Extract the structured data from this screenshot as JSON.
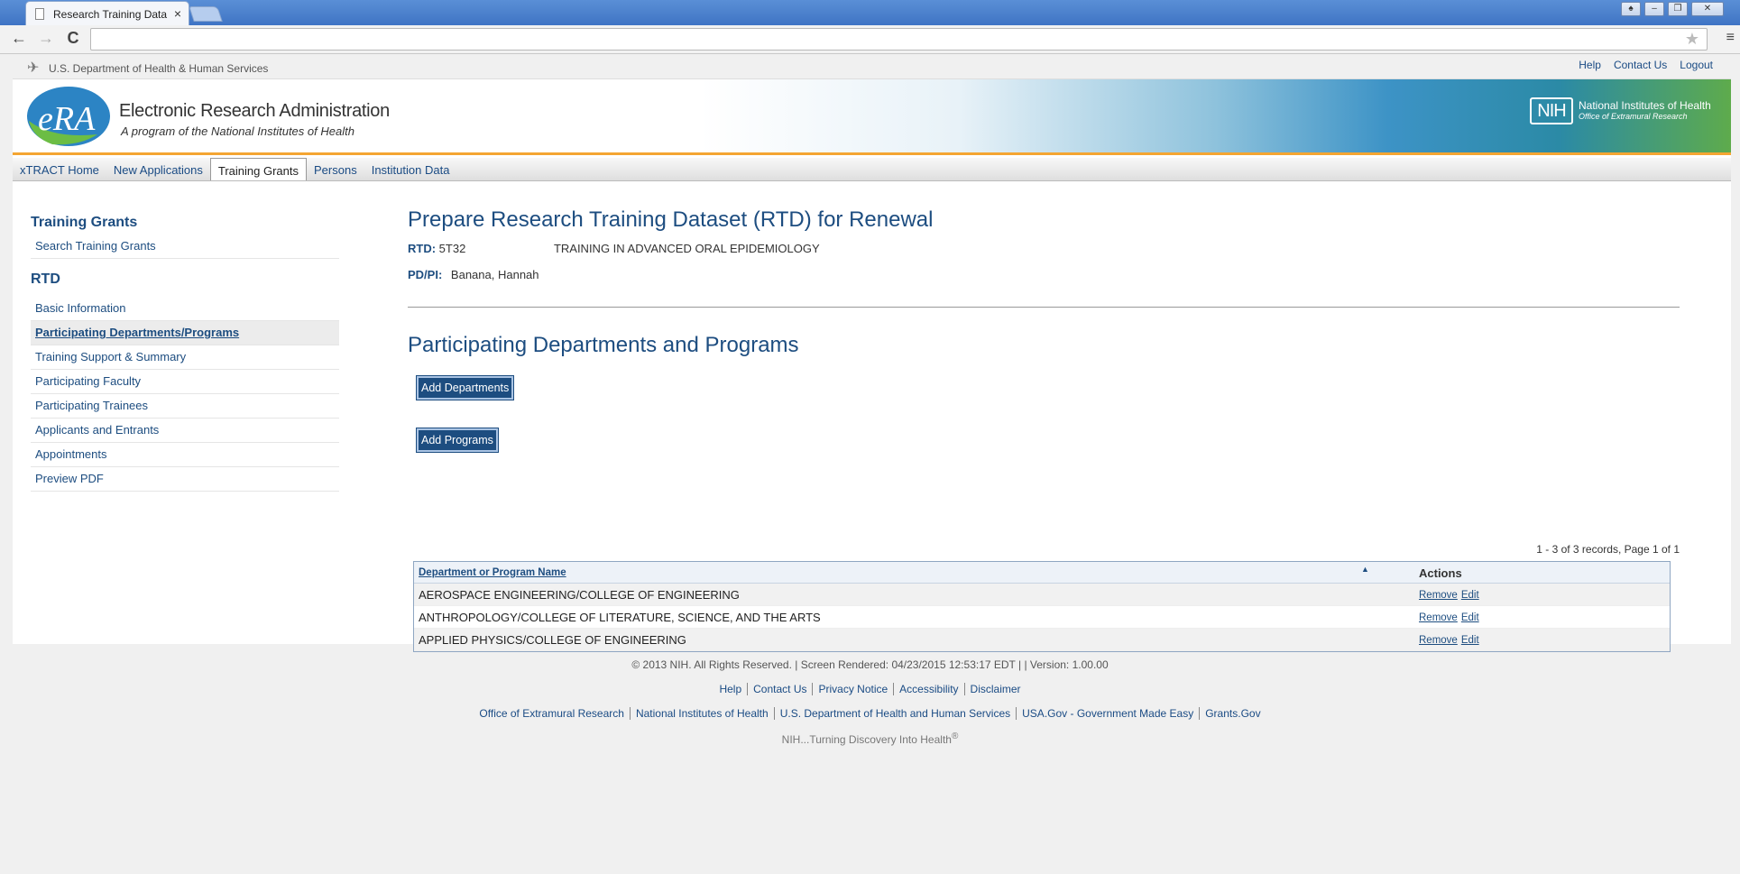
{
  "browser": {
    "tab_title": "Research Training Data",
    "tab_close": "×",
    "back": "←",
    "forward": "→",
    "reload": "C",
    "star": "★",
    "menu": "≡",
    "window_controls": [
      "♠",
      "–",
      "❐",
      "✕"
    ]
  },
  "header": {
    "hhs_label": "U.S. Department of Health & Human Services",
    "util_links": [
      "Help",
      "Contact Us",
      "Logout"
    ],
    "brand_logo_text": "eRA",
    "brand_title": "Electronic Research Administration",
    "brand_subtitle": "A program of the National Institutes of Health",
    "nih_box": "NIH",
    "nih_title": "National Institutes of Health",
    "nih_subtitle": "Office of Extramural Research"
  },
  "nav": {
    "items": [
      "xTRACT Home",
      "New Applications",
      "Training Grants",
      "Persons",
      "Institution Data"
    ],
    "active_index": 2
  },
  "sidebar": {
    "heading1": "Training Grants",
    "group1": [
      "Search Training Grants"
    ],
    "heading2": "RTD",
    "group2": [
      "Basic Information",
      "Participating Departments/Programs",
      "Training Support & Summary",
      "Participating Faculty",
      "Participating Trainees",
      "Applicants and Entrants",
      "Appointments",
      "Preview PDF"
    ],
    "active_item": "Participating Departments/Programs"
  },
  "main": {
    "page_title": "Prepare Research Training Dataset (RTD) for Renewal",
    "rtd_label": "RTD:",
    "rtd_value": "5T32",
    "rtd_title": "TRAINING IN ADVANCED ORAL EPIDEMIOLOGY",
    "pdpi_label": "PD/PI:",
    "pdpi_value": "Banana, Hannah",
    "section_title": "Participating Departments and Programs",
    "add_departments": "Add Departments",
    "add_programs": "Add Programs",
    "records_info": "1 - 3 of 3 records, Page 1 of 1",
    "grid": {
      "col_name": "Department or Program Name",
      "sort_icon": "▲",
      "col_actions": "Actions",
      "rows": [
        {
          "name": "AEROSPACE ENGINEERING/COLLEGE OF ENGINEERING",
          "remove": "Remove",
          "edit": "Edit"
        },
        {
          "name": "ANTHROPOLOGY/COLLEGE OF LITERATURE, SCIENCE, AND THE ARTS",
          "remove": "Remove",
          "edit": "Edit"
        },
        {
          "name": "APPLIED PHYSICS/COLLEGE OF ENGINEERING",
          "remove": "Remove",
          "edit": "Edit"
        }
      ]
    }
  },
  "footer": {
    "copyright": "© 2013 NIH. All Rights Reserved. | Screen Rendered: 04/23/2015 12:53:17 EDT | | Version: 1.00.00",
    "links1": [
      "Help",
      "Contact Us",
      "Privacy Notice",
      "Accessibility",
      "Disclaimer"
    ],
    "links2": [
      "Office of Extramural Research",
      "National Institutes of Health",
      "U.S. Department of Health and Human Services",
      "USA.Gov - Government Made Easy",
      "Grants.Gov"
    ],
    "tagline": "NIH...Turning Discovery Into Health",
    "tagline_mark": "®"
  }
}
